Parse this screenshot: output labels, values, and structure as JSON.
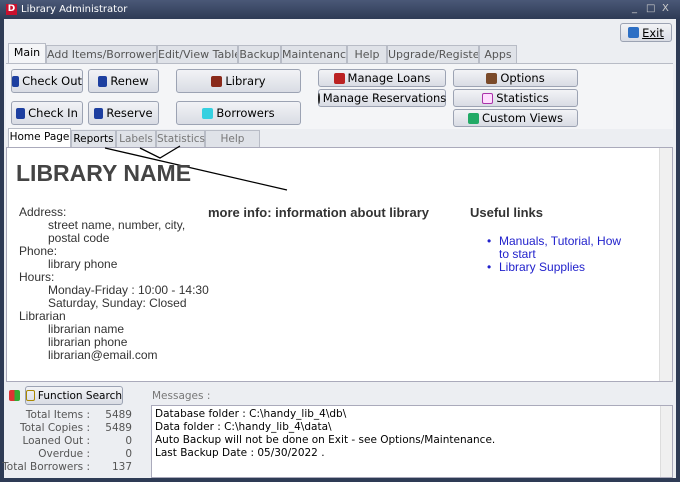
{
  "window": {
    "title": "Library Administrator",
    "minimize": "_",
    "maximize": "□",
    "close": "X"
  },
  "exit_label": "Exit",
  "main_tabs": [
    "Main",
    "Add Items/Borrowers",
    "Edit/View Table",
    "Backup",
    "Maintenance",
    "Help",
    "Upgrade/Register",
    "Apps"
  ],
  "toolbar": {
    "check_out": "Check Out",
    "renew": "Renew",
    "library": "Library",
    "check_in": "Check In",
    "reserve": "Reserve",
    "borrowers": "Borrowers",
    "manage_loans": "Manage Loans",
    "manage_reservations": "Manage Reservations",
    "options": "Options",
    "statistics": "Statistics",
    "custom_views": "Custom Views"
  },
  "sub_tabs": [
    "Home Page",
    "Reports",
    "Labels",
    "Statistics",
    "Help Links"
  ],
  "home": {
    "library_name": "LIBRARY NAME",
    "address_label": "Address:",
    "address_lines": [
      "street name, number, city,",
      "postal code"
    ],
    "phone_label": "Phone:",
    "phone": "library phone",
    "hours_label": "Hours:",
    "hours_lines": [
      "Monday-Friday : 10:00 - 14:30",
      "Saturday, Sunday: Closed"
    ],
    "librarian_label": "Librarian",
    "librarian_lines": [
      "librarian name",
      "librarian phone",
      "librarian@email.com"
    ],
    "more_info": "more info: information about library",
    "useful_links_title": "Useful links",
    "links": [
      "Manuals, Tutorial, How",
      "to start",
      "Library Supplies"
    ]
  },
  "function_search": "Function Search",
  "messages_label": "Messages :",
  "stats": [
    {
      "label": "Total Items :",
      "value": "5489"
    },
    {
      "label": "Total Copies :",
      "value": "5489"
    },
    {
      "label": "Loaned Out :",
      "value": "0"
    },
    {
      "label": "Overdue :",
      "value": "0"
    },
    {
      "label": "Total Borrowers :",
      "value": "137"
    }
  ],
  "messages": [
    "Database folder : C:\\handy_lib_4\\db\\",
    "Data folder : C:\\handy_lib_4\\data\\",
    "Auto Backup will not be done on Exit - see Options/Maintenance.",
    "Last Backup Date : 05/30/2022 ."
  ]
}
